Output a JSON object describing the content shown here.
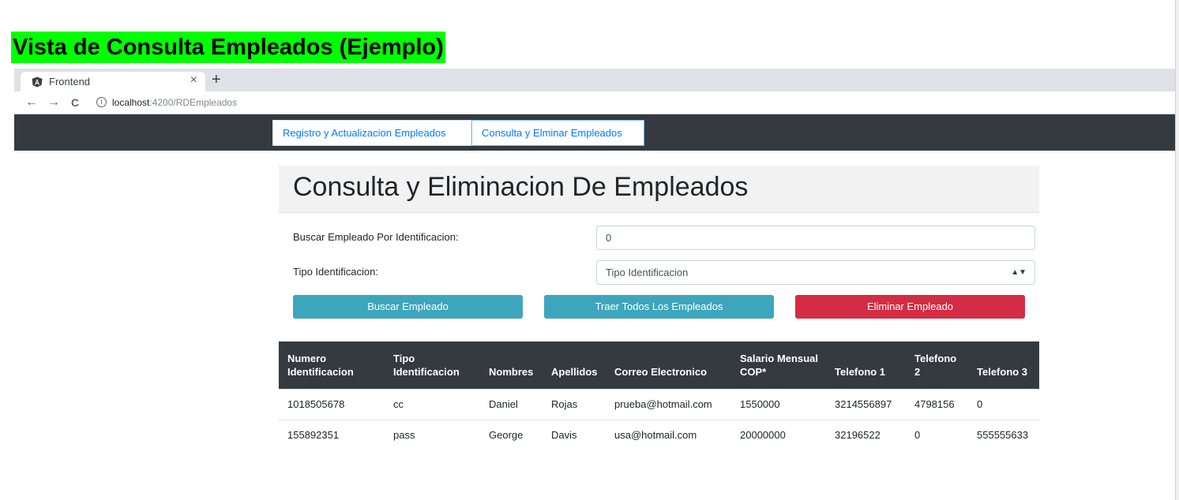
{
  "doc_title": "Vista de Consulta Empleados  (Ejemplo)",
  "browser": {
    "tab_title": "Frontend",
    "tab_close": "×",
    "new_tab": "+",
    "back": "←",
    "forward": "→",
    "reload": "C",
    "url_host": "localhost",
    "url_path": ":4200/RDEmpleados"
  },
  "nav": {
    "tabs": [
      {
        "label": "Registro y Actualizacion Empleados"
      },
      {
        "label": "Consulta y Elminar Empleados"
      }
    ]
  },
  "page": {
    "heading": "Consulta y Eliminacion De Empleados",
    "search_label": "Buscar Empleado Por Identificacion:",
    "search_value": "0",
    "tipo_label": "Tipo Identificacion:",
    "tipo_selected": "Tipo Identificacion",
    "buttons": {
      "search": "Buscar Empleado",
      "all": "Traer Todos Los Empleados",
      "delete": "Eliminar Empleado"
    }
  },
  "table": {
    "headers": [
      "Numero Identificacion",
      "Tipo Identificacion",
      "Nombres",
      "Apellidos",
      "Correo Electronico",
      "Salario Mensual COP*",
      "Telefono 1",
      "Telefono 2",
      "Telefono 3"
    ],
    "rows": [
      [
        "1018505678",
        "cc",
        "Daniel",
        "Rojas",
        "prueba@hotmail.com",
        "1550000",
        "3214556897",
        "4798156",
        "0"
      ],
      [
        "155892351",
        "pass",
        "George",
        "Davis",
        "usa@hotmail.com",
        "20000000",
        "32196522",
        "0",
        "555555633"
      ]
    ]
  },
  "colors": {
    "highlight": "#00ff00",
    "navbar": "#343a40",
    "info": "#3da6bd",
    "danger": "#d42c44",
    "link": "#007bff"
  }
}
